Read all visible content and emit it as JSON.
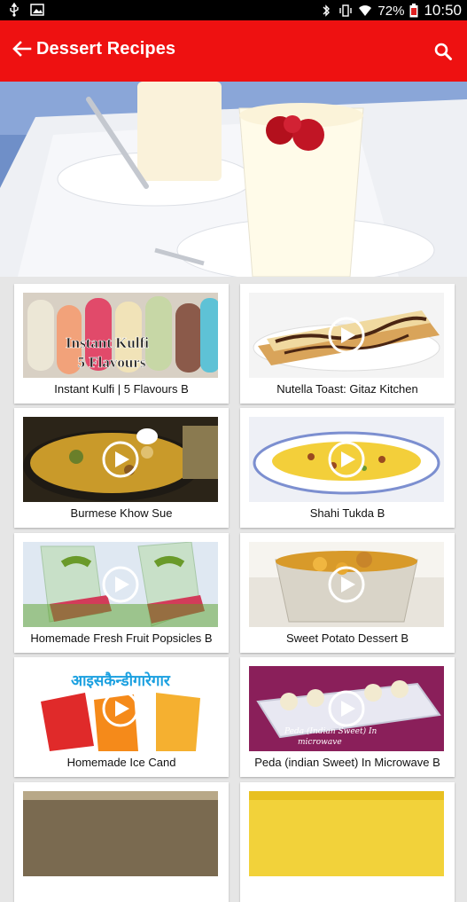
{
  "status_bar": {
    "battery": "72%",
    "time": "10:50"
  },
  "app_bar": {
    "title": "Dessert Recipes"
  },
  "videos": [
    {
      "title": "Instant Kulfi | 5 Flavours B",
      "thumb_text": "Instant Kulfi\n5 Flavours"
    },
    {
      "title": "Nutella Toast: Gitaz Kitchen"
    },
    {
      "title": "Burmese Khow Sue"
    },
    {
      "title": "Shahi Tukda B"
    },
    {
      "title": "Homemade Fresh Fruit Popsicles B"
    },
    {
      "title": "Sweet Potato Dessert B"
    },
    {
      "title": "Homemade Ice Cand",
      "thumb_text": "आइसकैन्डीगारेगार"
    },
    {
      "title": "Peda (indian Sweet) In Microwave  B",
      "thumb_text": "Peda (Indian Sweet) In microwave"
    }
  ]
}
